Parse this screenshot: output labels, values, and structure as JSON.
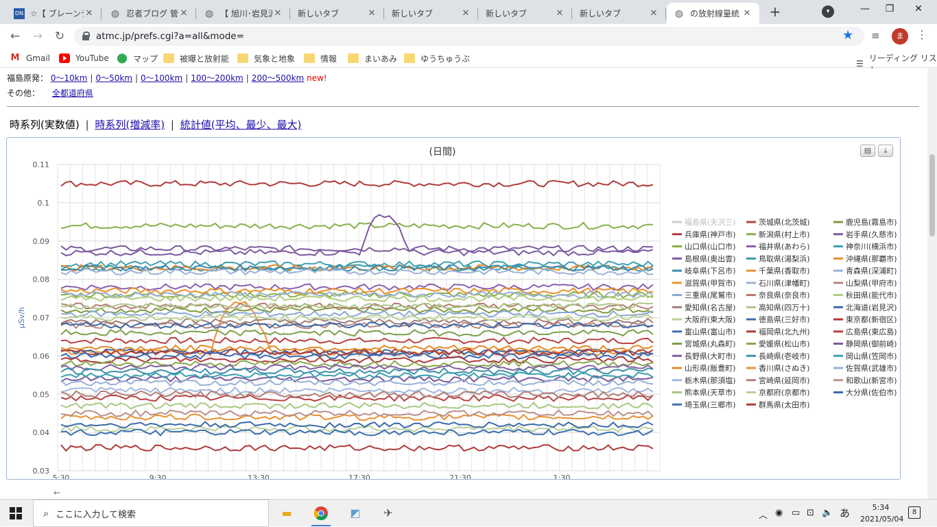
{
  "browser": {
    "tabs": [
      {
        "title": "☆【 ブレーンテキ",
        "icon": "dn-favicon"
      },
      {
        "title": "忍者ブログ 管理",
        "icon": "globe-icon"
      },
      {
        "title": "【 旭川･岩見沢",
        "icon": "globe-icon"
      },
      {
        "title": "新しいタブ",
        "icon": ""
      },
      {
        "title": "新しいタブ",
        "icon": ""
      },
      {
        "title": "新しいタブ",
        "icon": ""
      },
      {
        "title": "新しいタブ",
        "icon": ""
      },
      {
        "title": "の放射線量統",
        "icon": "globe-icon",
        "active": true
      }
    ],
    "url": "atmc.jp/prefs.cgi?a=all&mode=",
    "profile_initial": "ま",
    "bookmarks": [
      "Gmail",
      "YouTube",
      "マップ",
      "被曝と放射能",
      "気象と地象",
      "情報",
      "まいあみ",
      "ゆうちゅうぶ"
    ],
    "reading_list": "リーディング リスト"
  },
  "page": {
    "fukushima_label": "福島原発：",
    "fukushima_links": [
      "0～10km",
      "0～50km",
      "0～100km",
      "100～200km",
      "200～500km"
    ],
    "new_label": "new!",
    "other_label": "その他：",
    "other_link": "全都道府県",
    "mode_current": "時系列(実数値)",
    "mode_links": [
      "時系列(増減率)",
      "統計値(平均、最少、最大)"
    ],
    "sep": "|"
  },
  "chart_data": {
    "type": "line",
    "title": "(日間)",
    "ylabel": "μSv/h",
    "ylim": [
      0.03,
      0.11
    ],
    "yticks": [
      "0.03",
      "0.04",
      "0.05",
      "0.06",
      "0.07",
      "0.08",
      "0.09",
      "0.1",
      "0.11"
    ],
    "xticks": [
      "5:30",
      "9:30",
      "13:30",
      "17:30",
      "21:30",
      "1:30"
    ],
    "legend_position": "right",
    "series": [
      {
        "name": "福島県(夫沢三)",
        "color": "#cccccc",
        "base": null,
        "hidden": true
      },
      {
        "name": "茨城県(北茨城)",
        "color": "#b94040",
        "base": 0.064
      },
      {
        "name": "鹿児島(霧島市)",
        "color": "#7f9a3c",
        "base": 0.072
      },
      {
        "name": "兵庫県(神戸市)",
        "color": "#b03a3a",
        "base": 0.105
      },
      {
        "name": "新潟県(村上市)",
        "color": "#86b04a",
        "base": 0.094
      },
      {
        "name": "岩手県(久慈市)",
        "color": "#7a5a9a",
        "base": 0.088
      },
      {
        "name": "山口県(山口市)",
        "color": "#89b041",
        "base": 0.076
      },
      {
        "name": "福井県(あわら)",
        "color": "#8a5fb0",
        "base": 0.078
      },
      {
        "name": "神奈川(横浜市)",
        "color": "#3f9fb0",
        "base": 0.084
      },
      {
        "name": "島根県(奥出雲)",
        "color": "#7a58a0",
        "base": 0.087
      },
      {
        "name": "鳥取県(湯梨浜)",
        "color": "#3a98a8",
        "base": 0.083
      },
      {
        "name": "沖縄県(那覇市)",
        "color": "#e88a2a",
        "base": 0.083
      },
      {
        "name": "岐阜県(下呂市)",
        "color": "#3a8ab0",
        "base": 0.083
      },
      {
        "name": "千葉県(香取市)",
        "color": "#e8902a",
        "base": 0.077
      },
      {
        "name": "青森県(深浦町)",
        "color": "#9ab2d8",
        "base": 0.082
      },
      {
        "name": "滋賀県(甲賀市)",
        "color": "#f09030",
        "base": 0.061
      },
      {
        "name": "石川県(津幡町)",
        "color": "#9ab0d6",
        "base": 0.076
      },
      {
        "name": "山梨県(甲府市)",
        "color": "#b88880",
        "base": 0.068
      },
      {
        "name": "三重県(尾鷲市)",
        "color": "#88a8d8",
        "base": 0.071
      },
      {
        "name": "奈良県(奈良市)",
        "color": "#b87a70",
        "base": 0.073
      },
      {
        "name": "秋田県(能代市)",
        "color": "#b0cc80",
        "base": 0.075
      },
      {
        "name": "愛知県(名古屋)",
        "color": "#a07c78",
        "base": 0.069
      },
      {
        "name": "高知県(四万十)",
        "color": "#a8c888",
        "base": 0.073
      },
      {
        "name": "北海道(岩見沢)",
        "color": "#3a68a8",
        "base": 0.068
      },
      {
        "name": "大阪府(東大阪)",
        "color": "#b8d090",
        "base": 0.07
      },
      {
        "name": "徳島県(三好市)",
        "color": "#3e6aa8",
        "base": 0.061
      },
      {
        "name": "東京都(新宿区)",
        "color": "#b03838",
        "base": 0.061
      },
      {
        "name": "富山県(富山市)",
        "color": "#3a6ab0",
        "base": 0.06
      },
      {
        "name": "福岡県(北九州)",
        "color": "#b03a3a",
        "base": 0.059
      },
      {
        "name": "広島県(東広島)",
        "color": "#b84040",
        "base": 0.049
      },
      {
        "name": "宮城県(丸森町)",
        "color": "#7aa048",
        "base": 0.066
      },
      {
        "name": "愛媛県(松山市)",
        "color": "#86a84a",
        "base": 0.058
      },
      {
        "name": "静岡県(御前崎)",
        "color": "#7a5898",
        "base": 0.054
      },
      {
        "name": "長野県(大町市)",
        "color": "#8060a0",
        "base": 0.057
      },
      {
        "name": "長崎県(壱岐市)",
        "color": "#3a90a8",
        "base": 0.056
      },
      {
        "name": "岡山県(笠岡市)",
        "color": "#3aa0b0",
        "base": 0.055
      },
      {
        "name": "山形県(飯豊町)",
        "color": "#e08a28",
        "base": 0.062
      },
      {
        "name": "香川県(さぬき)",
        "color": "#e89030",
        "base": 0.044
      },
      {
        "name": "佐賀県(武雄市)",
        "color": "#98b0d8",
        "base": 0.053
      },
      {
        "name": "栃木県(那須塩)",
        "color": "#a0b8e0",
        "base": 0.051
      },
      {
        "name": "宮崎県(延岡市)",
        "color": "#b08078",
        "base": 0.05
      },
      {
        "name": "和歌山(新宮市)",
        "color": "#b89088",
        "base": 0.045
      },
      {
        "name": "熊本県(天草市)",
        "color": "#a8c880",
        "base": 0.047
      },
      {
        "name": "京都府(京都市)",
        "color": "#b8d098",
        "base": 0.041
      },
      {
        "name": "大分県(佐伯市)",
        "color": "#3a6aa8",
        "base": 0.042
      },
      {
        "name": "埼玉県(三郷市)",
        "color": "#3a70b0",
        "base": 0.04
      },
      {
        "name": "群馬県(太田市)",
        "color": "#b03a3a",
        "base": 0.036
      }
    ]
  },
  "taskbar": {
    "search_placeholder": "ここに入力して検索",
    "time": "5:34",
    "date": "2021/05/04",
    "ime": "あ",
    "notifications": "8"
  }
}
